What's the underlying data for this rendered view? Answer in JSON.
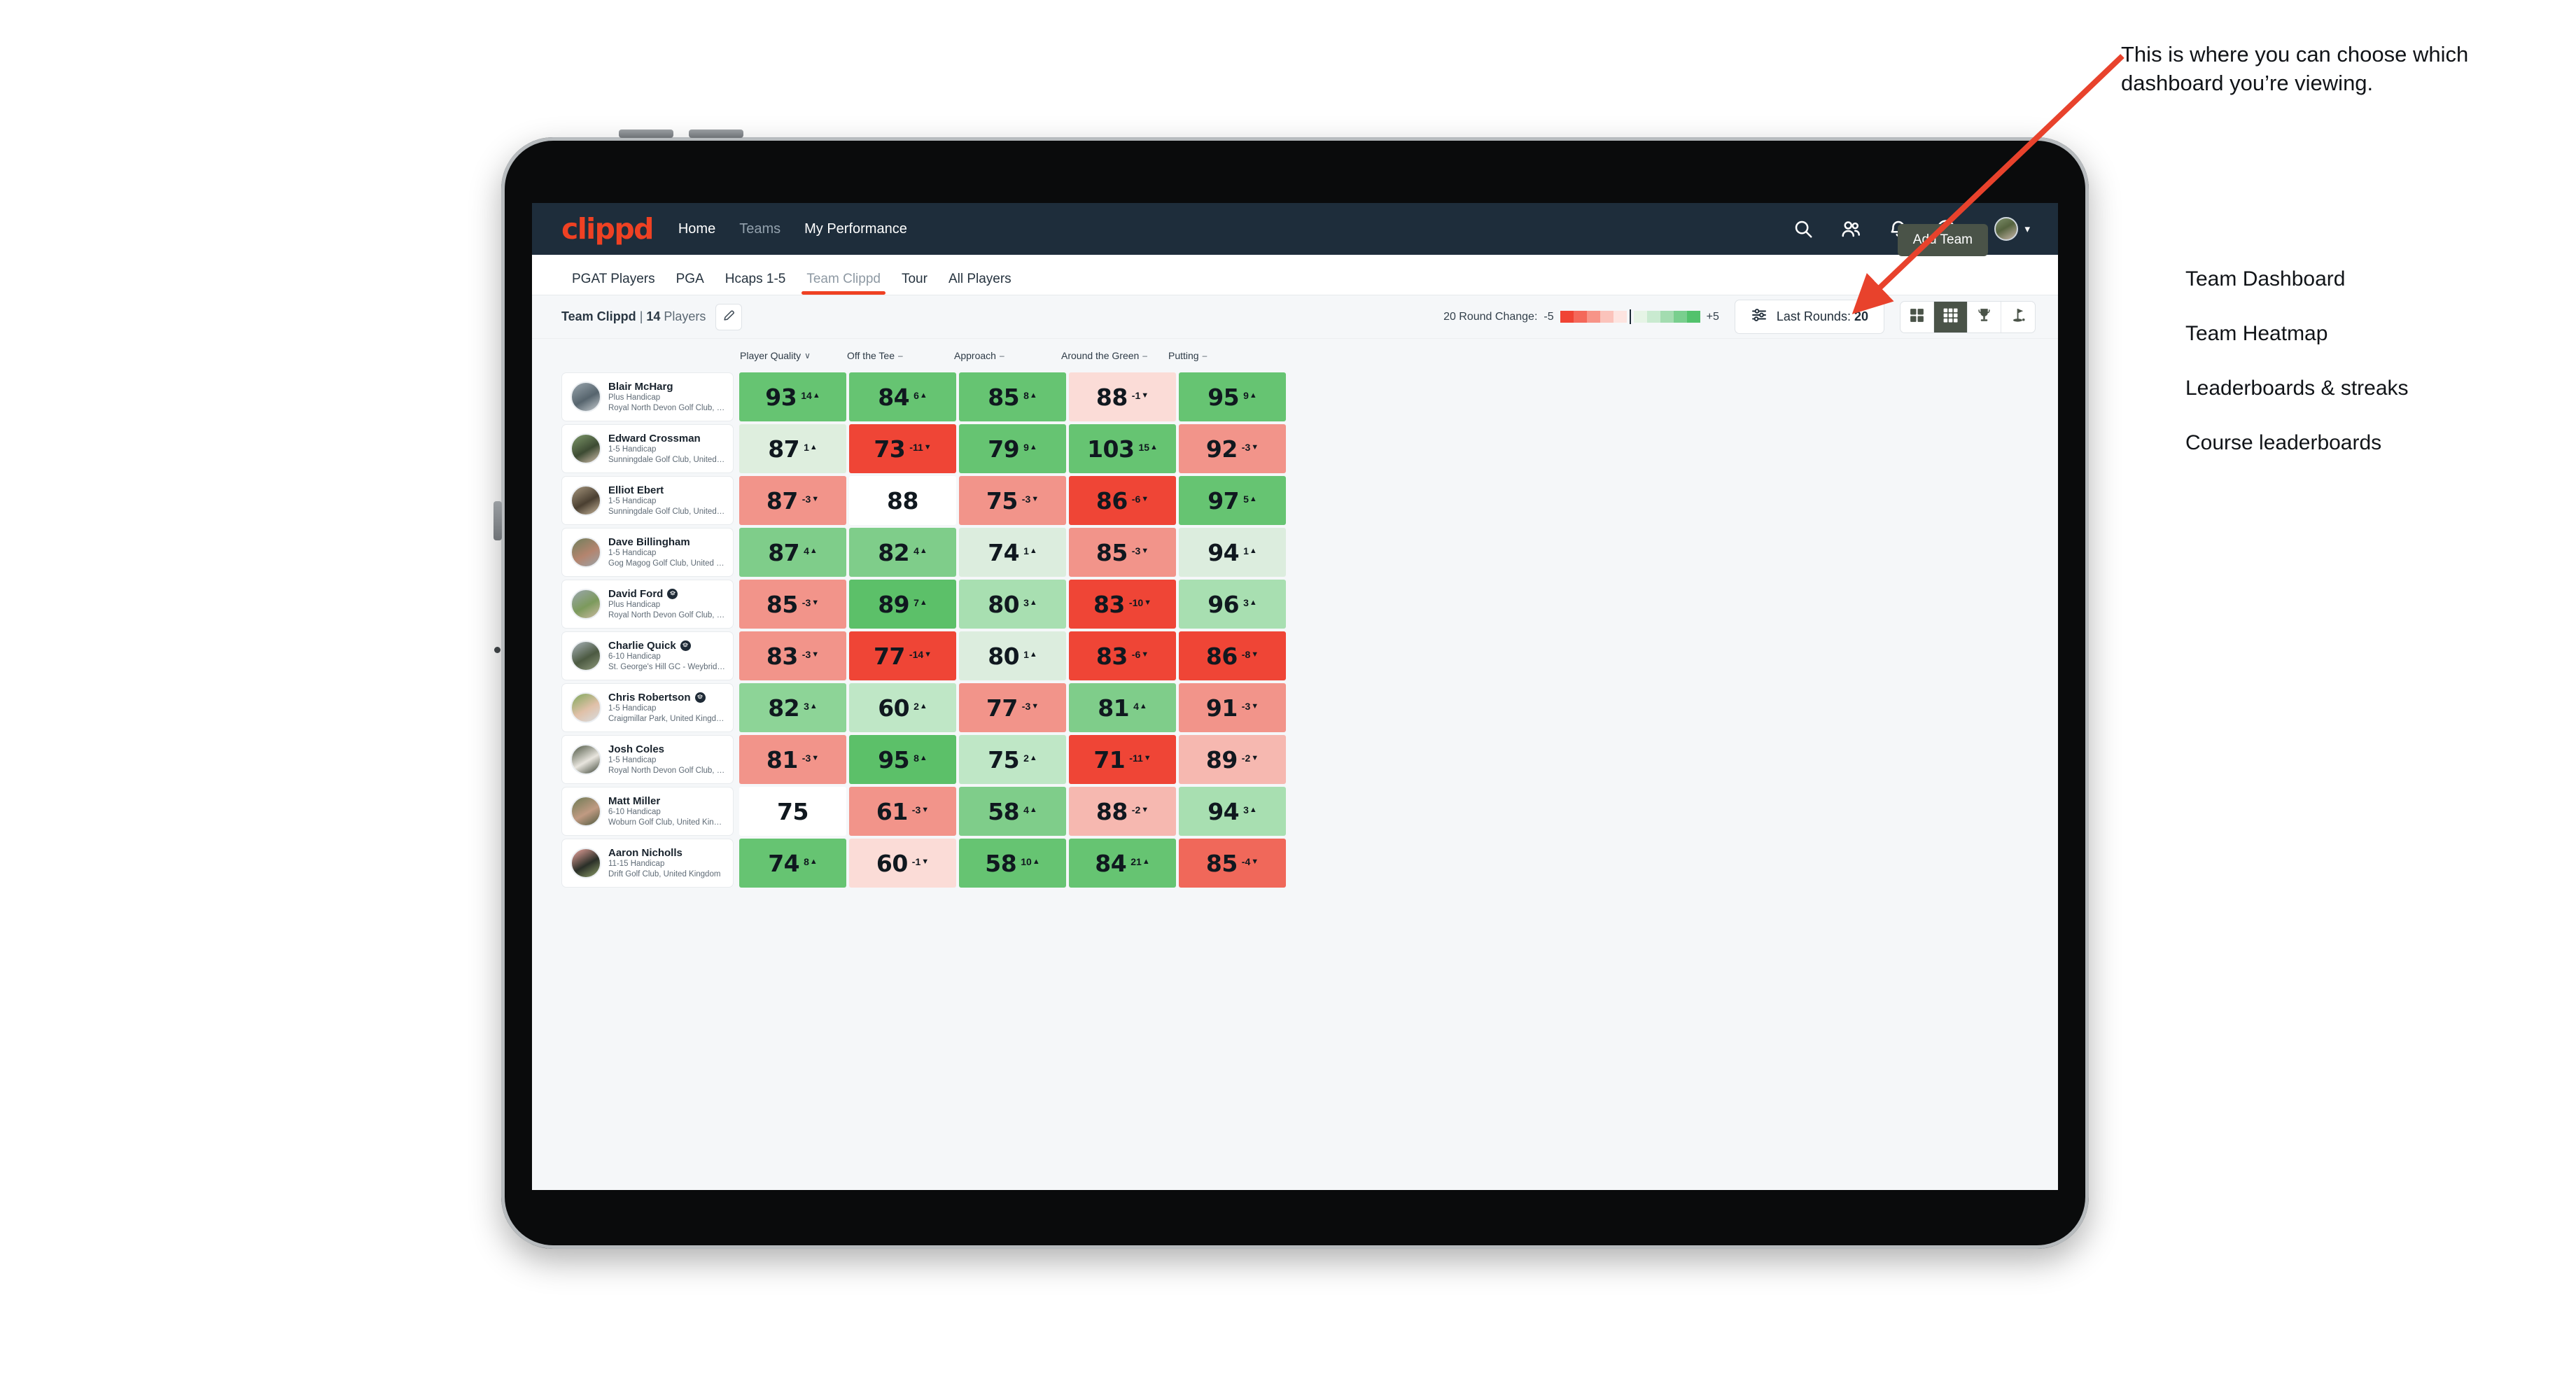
{
  "app": {
    "brand": "clippd",
    "nav": [
      {
        "label": "Home",
        "muted": false
      },
      {
        "label": "Teams",
        "muted": true
      },
      {
        "label": "My Performance",
        "muted": false
      }
    ],
    "top_icons": [
      {
        "name": "search-icon"
      },
      {
        "name": "people-icon"
      },
      {
        "name": "bell-icon"
      },
      {
        "name": "plus-circle-icon"
      },
      {
        "name": "avatar"
      }
    ]
  },
  "subtabs": {
    "items": [
      {
        "label": "PGAT Players",
        "active": false
      },
      {
        "label": "PGA",
        "active": false
      },
      {
        "label": "Hcaps 1-5",
        "active": false
      },
      {
        "label": "Team Clippd",
        "active": true
      },
      {
        "label": "Tour",
        "active": false
      },
      {
        "label": "All Players",
        "active": false
      }
    ],
    "add_team_label": "Add Team"
  },
  "toolbar": {
    "team_name": "Team Clippd",
    "team_separator": " | ",
    "team_count": "14",
    "team_count_suffix": " Players",
    "edit_icon": "pencil-icon",
    "legend_label": "20 Round Change:",
    "legend_min": "-5",
    "legend_max": "+5",
    "legend_colors": [
      "#f04434",
      "#f4685a",
      "#f79488",
      "#fbc3bb",
      "#fde4e0",
      "#e6f4e6",
      "#c9ead0",
      "#a3dcb0",
      "#79cf8e",
      "#52c26c"
    ],
    "rounds_filter_label": "Last Rounds:",
    "rounds_filter_value": "20",
    "rounds_filter_icon": "sliders-icon",
    "view_toggle": [
      {
        "name": "grid-4-icon",
        "active": false
      },
      {
        "name": "grid-9-icon",
        "active": true
      },
      {
        "name": "trophy-icon",
        "active": false
      },
      {
        "name": "golf-flag-icon",
        "active": false
      }
    ]
  },
  "columns": [
    {
      "label": "Player Quality",
      "marker": "∨"
    },
    {
      "label": "Off the Tee",
      "marker": "–"
    },
    {
      "label": "Approach",
      "marker": "–"
    },
    {
      "label": "Around the Green",
      "marker": "–"
    },
    {
      "label": "Putting",
      "marker": "–"
    }
  ],
  "rows": [
    {
      "name": "Blair McHarg",
      "verified": false,
      "handicap": "Plus Handicap",
      "club": "Royal North Devon Golf Club, United Kingdom",
      "avatar_colors": [
        "#9aa6ae",
        "#56646d",
        "#c7cdd1"
      ],
      "cells": [
        {
          "value": "93",
          "delta": "14",
          "dir": "up",
          "bg": "#66c472"
        },
        {
          "value": "84",
          "delta": "6",
          "dir": "up",
          "bg": "#66c472"
        },
        {
          "value": "85",
          "delta": "8",
          "dir": "up",
          "bg": "#66c472"
        },
        {
          "value": "88",
          "delta": "-1",
          "dir": "down",
          "bg": "#fbdcd7"
        },
        {
          "value": "95",
          "delta": "9",
          "dir": "up",
          "bg": "#66c472"
        }
      ]
    },
    {
      "name": "Edward Crossman",
      "verified": false,
      "handicap": "1-5 Handicap",
      "club": "Sunningdale Golf Club, United Kingdom",
      "avatar_colors": [
        "#7f9a6b",
        "#3d4b33",
        "#d5c2b0"
      ],
      "cells": [
        {
          "value": "87",
          "delta": "1",
          "dir": "up",
          "bg": "#deeede"
        },
        {
          "value": "73",
          "delta": "-11",
          "dir": "down",
          "bg": "#ef4536"
        },
        {
          "value": "79",
          "delta": "9",
          "dir": "up",
          "bg": "#66c472"
        },
        {
          "value": "103",
          "delta": "15",
          "dir": "up",
          "bg": "#66c472"
        },
        {
          "value": "92",
          "delta": "-3",
          "dir": "down",
          "bg": "#f2948a"
        }
      ]
    },
    {
      "name": "Elliot Ebert",
      "verified": false,
      "handicap": "1-5 Handicap",
      "club": "Sunningdale Golf Club, United Kingdom",
      "avatar_colors": [
        "#a8987f",
        "#4a3f31",
        "#c9b79c"
      ],
      "cells": [
        {
          "value": "87",
          "delta": "-3",
          "dir": "down",
          "bg": "#f2948a"
        },
        {
          "value": "88",
          "delta": "",
          "dir": "",
          "bg": "#ffffff"
        },
        {
          "value": "75",
          "delta": "-3",
          "dir": "down",
          "bg": "#f2948a"
        },
        {
          "value": "86",
          "delta": "-6",
          "dir": "down",
          "bg": "#ef4536"
        },
        {
          "value": "97",
          "delta": "5",
          "dir": "up",
          "bg": "#66c472"
        }
      ]
    },
    {
      "name": "Dave Billingham",
      "verified": false,
      "handicap": "1-5 Handicap",
      "club": "Gog Magog Golf Club, United Kingdom",
      "avatar_colors": [
        "#6f7f5c",
        "#b4846e",
        "#9aa3a8"
      ],
      "cells": [
        {
          "value": "87",
          "delta": "4",
          "dir": "up",
          "bg": "#7fcd8a"
        },
        {
          "value": "82",
          "delta": "4",
          "dir": "up",
          "bg": "#7fcd8a"
        },
        {
          "value": "74",
          "delta": "1",
          "dir": "up",
          "bg": "#dcedde"
        },
        {
          "value": "85",
          "delta": "-3",
          "dir": "down",
          "bg": "#f2948a"
        },
        {
          "value": "94",
          "delta": "1",
          "dir": "up",
          "bg": "#dcedde"
        }
      ]
    },
    {
      "name": "David Ford",
      "verified": true,
      "handicap": "Plus Handicap",
      "club": "Royal North Devon Golf Club, United Kingdom",
      "avatar_colors": [
        "#9aa6ae",
        "#7c9a5c",
        "#cdbba3"
      ],
      "cells": [
        {
          "value": "85",
          "delta": "-3",
          "dir": "down",
          "bg": "#f2948a"
        },
        {
          "value": "89",
          "delta": "7",
          "dir": "up",
          "bg": "#5cc069"
        },
        {
          "value": "80",
          "delta": "3",
          "dir": "up",
          "bg": "#a8dfb1"
        },
        {
          "value": "83",
          "delta": "-10",
          "dir": "down",
          "bg": "#ef4536"
        },
        {
          "value": "96",
          "delta": "3",
          "dir": "up",
          "bg": "#a8dfb1"
        }
      ]
    },
    {
      "name": "Charlie Quick",
      "verified": true,
      "handicap": "6-10 Handicap",
      "club": "St. George's Hill GC - Weybridge - Surrey, Uni...",
      "avatar_colors": [
        "#aab4bb",
        "#4c5a42",
        "#8f9a7d"
      ],
      "cells": [
        {
          "value": "83",
          "delta": "-3",
          "dir": "down",
          "bg": "#f2948a"
        },
        {
          "value": "77",
          "delta": "-14",
          "dir": "down",
          "bg": "#ef4536"
        },
        {
          "value": "80",
          "delta": "1",
          "dir": "up",
          "bg": "#dcedde"
        },
        {
          "value": "83",
          "delta": "-6",
          "dir": "down",
          "bg": "#ef4536"
        },
        {
          "value": "86",
          "delta": "-8",
          "dir": "down",
          "bg": "#ef4536"
        }
      ]
    },
    {
      "name": "Chris Robertson",
      "verified": true,
      "handicap": "1-5 Handicap",
      "club": "Craigmillar Park, United Kingdom",
      "avatar_colors": [
        "#7fa85c",
        "#e0c0a8",
        "#d8dde0"
      ],
      "cells": [
        {
          "value": "82",
          "delta": "3",
          "dir": "up",
          "bg": "#8dd497"
        },
        {
          "value": "60",
          "delta": "2",
          "dir": "up",
          "bg": "#bfe7c6"
        },
        {
          "value": "77",
          "delta": "-3",
          "dir": "down",
          "bg": "#f2948a"
        },
        {
          "value": "81",
          "delta": "4",
          "dir": "up",
          "bg": "#7fcd8a"
        },
        {
          "value": "91",
          "delta": "-3",
          "dir": "down",
          "bg": "#f2948a"
        }
      ]
    },
    {
      "name": "Josh Coles",
      "verified": false,
      "handicap": "1-5 Handicap",
      "club": "Royal North Devon Golf Club, United Kingdom",
      "avatar_colors": [
        "#4a5340",
        "#e8e5de",
        "#3c4436"
      ],
      "cells": [
        {
          "value": "81",
          "delta": "-3",
          "dir": "down",
          "bg": "#f2948a"
        },
        {
          "value": "95",
          "delta": "8",
          "dir": "up",
          "bg": "#5cc069"
        },
        {
          "value": "75",
          "delta": "2",
          "dir": "up",
          "bg": "#bfe7c6"
        },
        {
          "value": "71",
          "delta": "-11",
          "dir": "down",
          "bg": "#ef4536"
        },
        {
          "value": "89",
          "delta": "-2",
          "dir": "down",
          "bg": "#f6b8b0"
        }
      ]
    },
    {
      "name": "Matt Miller",
      "verified": false,
      "handicap": "6-10 Handicap",
      "club": "Woburn Golf Club, United Kingdom",
      "avatar_colors": [
        "#6d7a54",
        "#c09a82",
        "#4e5a3f"
      ],
      "cells": [
        {
          "value": "75",
          "delta": "",
          "dir": "",
          "bg": "#ffffff"
        },
        {
          "value": "61",
          "delta": "-3",
          "dir": "down",
          "bg": "#f2948a"
        },
        {
          "value": "58",
          "delta": "4",
          "dir": "up",
          "bg": "#7fcd8a"
        },
        {
          "value": "88",
          "delta": "-2",
          "dir": "down",
          "bg": "#f6b8b0"
        },
        {
          "value": "94",
          "delta": "3",
          "dir": "up",
          "bg": "#a8dfb1"
        }
      ]
    },
    {
      "name": "Aaron Nicholls",
      "verified": false,
      "handicap": "11-15 Handicap",
      "club": "Drift Golf Club, United Kingdom",
      "avatar_colors": [
        "#f0a8a0",
        "#2a2f28",
        "#8fa06a"
      ],
      "cells": [
        {
          "value": "74",
          "delta": "8",
          "dir": "up",
          "bg": "#66c472"
        },
        {
          "value": "60",
          "delta": "-1",
          "dir": "down",
          "bg": "#fbdcd7"
        },
        {
          "value": "58",
          "delta": "10",
          "dir": "up",
          "bg": "#66c472"
        },
        {
          "value": "84",
          "delta": "21",
          "dir": "up",
          "bg": "#66c472"
        },
        {
          "value": "85",
          "delta": "-4",
          "dir": "down",
          "bg": "#f0685a"
        }
      ]
    }
  ],
  "annotation": {
    "callout": "This is where you can choose which dashboard you’re viewing.",
    "items": [
      "Team Dashboard",
      "Team Heatmap",
      "Leaderboards & streaks",
      "Course leaderboards"
    ],
    "arrow_color": "#e8422c"
  }
}
